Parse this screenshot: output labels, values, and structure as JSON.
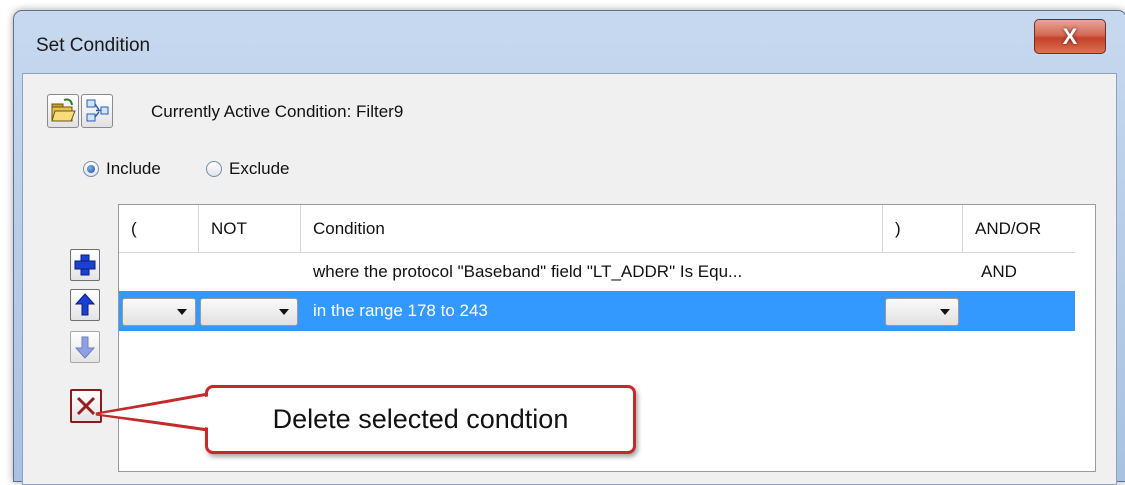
{
  "window": {
    "title": "Set Condition",
    "close_glyph": "X"
  },
  "toolbar": {
    "open_icon": "folder-open-icon",
    "link_icon": "link-filter-icon",
    "active_label": "Currently Active Condition:  Filter9"
  },
  "mode": {
    "include_label": "Include",
    "exclude_label": "Exclude",
    "selected": "Include"
  },
  "side_buttons": [
    "add-icon",
    "move-up-icon",
    "move-down-icon",
    "delete-icon"
  ],
  "grid": {
    "headers": [
      "(",
      "NOT",
      "Condition",
      ")",
      "AND/OR"
    ],
    "rows": [
      {
        "open": "",
        "not": "",
        "condition": "where the protocol \"Baseband\" field \"LT_ADDR\" Is Equ...",
        "close": "",
        "andor": "AND",
        "selected": false
      },
      {
        "open": "",
        "not": "",
        "condition": "in the range 178 to 243",
        "close": "",
        "andor": "",
        "selected": true
      }
    ]
  },
  "callout": {
    "text": "Delete selected condtion"
  },
  "colors": {
    "selection": "#3399ff",
    "callout_border": "#c32a2a",
    "add_icon": "#1c3fd6",
    "delete_icon": "#9b1c1c"
  }
}
